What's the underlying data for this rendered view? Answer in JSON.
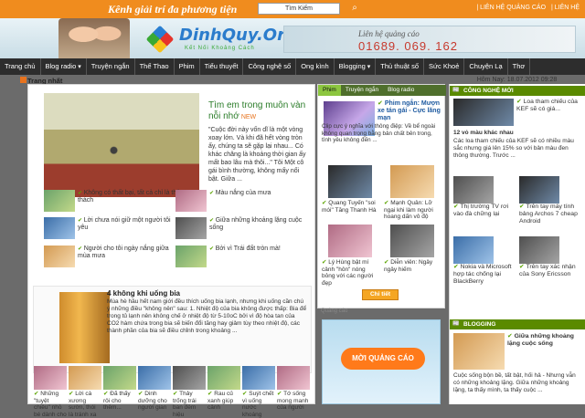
{
  "topbar": {
    "tagline": "Kênh giải trí đa phương tiện",
    "search_label": "Tìm Kiếm",
    "links": [
      "| LIÊN HỆ QUẢNG CÁO",
      "| LIÊN HỆ"
    ]
  },
  "header": {
    "logo": "DinhQuy.Org",
    "logo_sub": "Kết Nối Khoảng Cách",
    "ad_text": "Liên hệ quảng cáo",
    "ad_phone": "01689. 069. 162"
  },
  "nav": [
    "Trang chủ",
    "Blog radio",
    "Truyện ngắn",
    "Thể Thao",
    "Phim",
    "Tiểu thuyết",
    "Công nghệ số",
    "Ong kình",
    "Blogging",
    "Thủ thuật số",
    "Sức Khoẻ",
    "Chuyện Lạ",
    "Thơ"
  ],
  "main": {
    "section_title": "Trang nhất",
    "feature_title": "Tìm em trong muôn vàn nỗi nhớ",
    "feature_badge": "NEW",
    "feature_desc": "\"Cuộc đời này vốn dĩ là một vòng xoay lớn. Và khi đã hết vòng tròn ấy, chúng ta sẽ gặp lại nhau... Có khác chăng là khoảng thời gian ấy mất bao lâu mà thôi...\"  Tôi   Một cô gái bình thường, không mấy nổi bật. Giữa ...",
    "related": [
      "Không có thất bại, tất cả chỉ là thử thách",
      "Màu nắng của mưa",
      "Lời chưa nói giữ một người tôi yêu",
      "Giữa những khoảng lặng cuộc sống",
      "Người cho tôi ngày nắng giữa mùa mưa",
      "Bởi vì Trái đất tròn mà!"
    ],
    "story2_title": "4 không khi uống bia",
    "story2_desc": "Mùa hè hầu hết nam giới đều thích uống bia lạnh, nhưng khi uống cần chú ý những điều \"không nên\" sau: 1. Nhiệt độ của bia không được thấp: Bia để trong tủ lạnh nên không chế ở nhiệt độ từ 5-10oC bởi vì độ hòa tan của CO2 hàm chứa trong bia sẽ biến đổi tăng hay giảm tùy theo nhiệt độ, các thành phần của bia sẽ điều chỉnh trong khoảng ...",
    "bottom": [
      "Những \"tuyệt chiêu\" nhỏ bé dành cho",
      "Lời cà xương sườn, thói là tránh xa",
      "Đã thấy rôi cho thêm...",
      "Dinh dưỡng cho người gian",
      "Thảy trống trái ban đêm hiệu",
      "Rau củ xanh giúp cảnh",
      "Suýt chết vì uống nước khoáng",
      "Tớ sống mong manh của người"
    ]
  },
  "middle": {
    "tabs": [
      "Phim",
      "Truyện ngắn",
      "Blog radio"
    ],
    "feature_title": "Phim ngắn: Mượn xe tán gái - Cực lãng mạn",
    "feature_desc": "Clip cực ý nghĩa với thông điệp: Về bể ngoài không quan trọng bằng bản chất bên trong, tình yêu không đến ...",
    "grid": [
      "Quang Tuyến \"soi mói\" Tăng Thanh Hà",
      "Mạnh Quân: Lỡ ngại khi làm người hoang dấn vô độ",
      "Lý Hùng bật mí cảnh \"hôn\" nóng bỏng với các người đẹp",
      "Diễn viên: Ngây ngây hiếm"
    ],
    "detail_button": "Chi tiết",
    "ad_label": "Quảng cáo",
    "ad_text": "MỜI QUẢNG CÁO"
  },
  "right": {
    "date": "Hôm Nay: 18.07.2012 09:28",
    "tech_header": "CÔNG NGHỆ MỚI",
    "tech_top": "Loa tham chiếu của KEF sẽ có giá...",
    "tech_sub": "12 vỏ màu khác nhau",
    "tech_desc": "Các loa tham chiếu của KEF sẽ có nhiều màu sắc nhưng giá lên 15% so với bản màu đen thông thường. Trước ...",
    "items": [
      "Thị trường TV rơi vào đà chững lại",
      "Trên tay máy tính bảng Archos 7 cheap Android",
      "Nokia và Microsoft hợp tác chống lại BlackBerry",
      "Trên tay xác nhận của Sony Ericsson"
    ],
    "blogging_header": "BLOGGING",
    "blog_title": "Giữa những khoảng lặng cuộc sống",
    "blog_desc": "Cuộc sống bộn bề, tất bật, hối hả - Nhưng vẫn có những khoảng lặng. Giữa những khoảng lặng, ta thấy mình, ta thấy cuộc ..."
  }
}
